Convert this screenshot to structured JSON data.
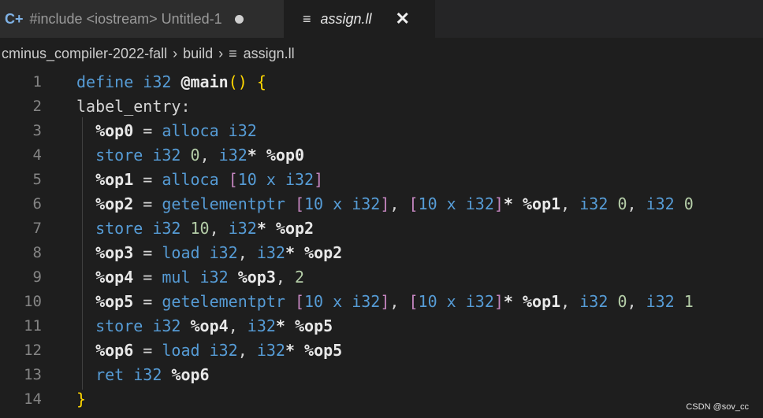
{
  "tabs": {
    "tab1": {
      "label": "#include <iostream> Untitled-1",
      "icon": "c-file-icon"
    },
    "tab2": {
      "label": "assign.ll",
      "icon": "menu-icon"
    }
  },
  "breadcrumb": {
    "items": [
      "cminus_compiler-2022-fall",
      "build",
      "assign.ll"
    ]
  },
  "code": {
    "lines": [
      {
        "n": "1"
      },
      {
        "n": "2"
      },
      {
        "n": "3"
      },
      {
        "n": "4"
      },
      {
        "n": "5"
      },
      {
        "n": "6"
      },
      {
        "n": "7"
      },
      {
        "n": "8"
      },
      {
        "n": "9"
      },
      {
        "n": "10"
      },
      {
        "n": "11"
      },
      {
        "n": "12"
      },
      {
        "n": "13"
      },
      {
        "n": "14"
      }
    ]
  },
  "watermark": "CSDN @sov_cc",
  "colors": {
    "background": "#1e1e1e",
    "keyword": "#569cd6",
    "number": "#b5cea8",
    "bracket": "#c586c0",
    "paren": "#ffd700"
  }
}
